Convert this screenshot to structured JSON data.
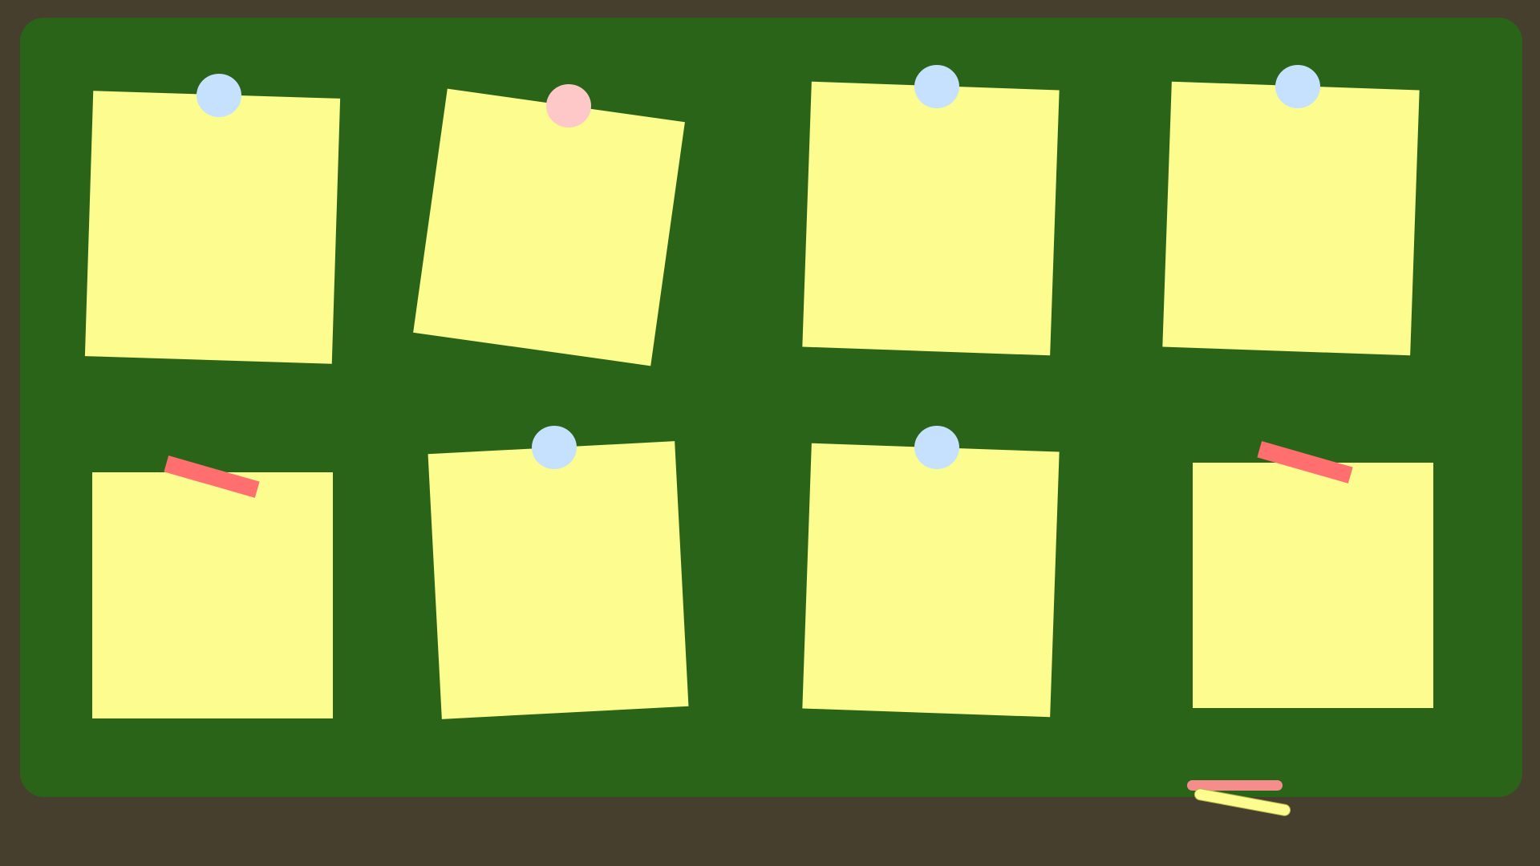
{
  "colors": {
    "frame": "#463f2e",
    "board": "#2a6419",
    "note": "#fcfc8f",
    "pin_blue": "#c5e1fd",
    "pin_pink": "#ffc8c8",
    "tape": "#ff6f6f",
    "chalk_pink": "#f68d8d",
    "chalk_yellow": "#fcfc8f"
  },
  "notes_count": 8,
  "pins": [
    "blue",
    "pink",
    "blue",
    "blue",
    "blue",
    "blue"
  ],
  "tapes_count": 2,
  "chalk": [
    {
      "icon": "chalk-icon",
      "color": "pink"
    },
    {
      "icon": "chalk-icon",
      "color": "yellow"
    }
  ]
}
